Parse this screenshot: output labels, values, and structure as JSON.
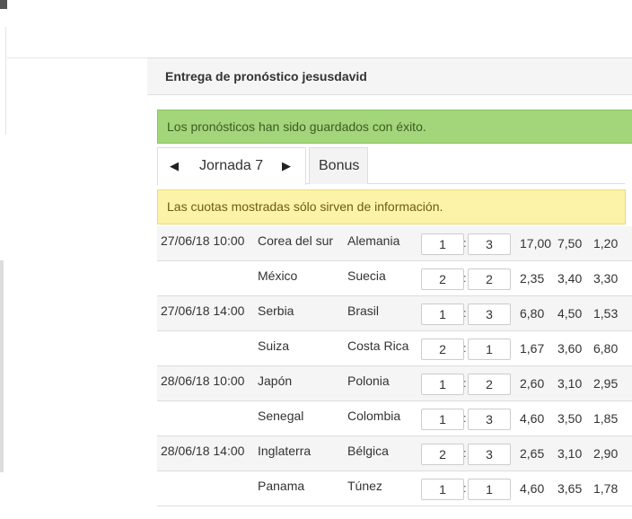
{
  "panel": {
    "title": "Entrega de pronóstico jesusdavid"
  },
  "alerts": {
    "success": "Los pronósticos han sido guardados con éxito.",
    "warning": "Las cuotas mostradas sólo sirven de información."
  },
  "tabs": {
    "jornada_label": "Jornada 7",
    "prev_arrow": "◀",
    "next_arrow": "▶",
    "bonus_label": "Bonus"
  },
  "matches": [
    {
      "date": "27/06/18 10:00",
      "home": "Corea del sur",
      "away": "Alemania",
      "score_home": "1",
      "score_away": "3",
      "odd_1": "17,00",
      "odd_x": "7,50",
      "odd_2": "1,20"
    },
    {
      "date": "",
      "home": "México",
      "away": "Suecia",
      "score_home": "2",
      "score_away": "2",
      "odd_1": "2,35",
      "odd_x": "3,40",
      "odd_2": "3,30"
    },
    {
      "date": "27/06/18 14:00",
      "home": "Serbia",
      "away": "Brasil",
      "score_home": "1",
      "score_away": "3",
      "odd_1": "6,80",
      "odd_x": "4,50",
      "odd_2": "1,53"
    },
    {
      "date": "",
      "home": "Suiza",
      "away": "Costa Rica",
      "score_home": "2",
      "score_away": "1",
      "odd_1": "1,67",
      "odd_x": "3,60",
      "odd_2": "6,80"
    },
    {
      "date": "28/06/18 10:00",
      "home": "Japón",
      "away": "Polonia",
      "score_home": "1",
      "score_away": "2",
      "odd_1": "2,60",
      "odd_x": "3,10",
      "odd_2": "2,95"
    },
    {
      "date": "",
      "home": "Senegal",
      "away": "Colombia",
      "score_home": "1",
      "score_away": "3",
      "odd_1": "4,60",
      "odd_x": "3,50",
      "odd_2": "1,85"
    },
    {
      "date": "28/06/18 14:00",
      "home": "Inglaterra",
      "away": "Bélgica",
      "score_home": "2",
      "score_away": "3",
      "odd_1": "2,65",
      "odd_x": "3,10",
      "odd_2": "2,90"
    },
    {
      "date": "",
      "home": "Panama",
      "away": "Túnez",
      "score_home": "1",
      "score_away": "1",
      "odd_1": "4,60",
      "odd_x": "3,65",
      "odd_2": "1,78"
    }
  ],
  "score_separator": ":"
}
